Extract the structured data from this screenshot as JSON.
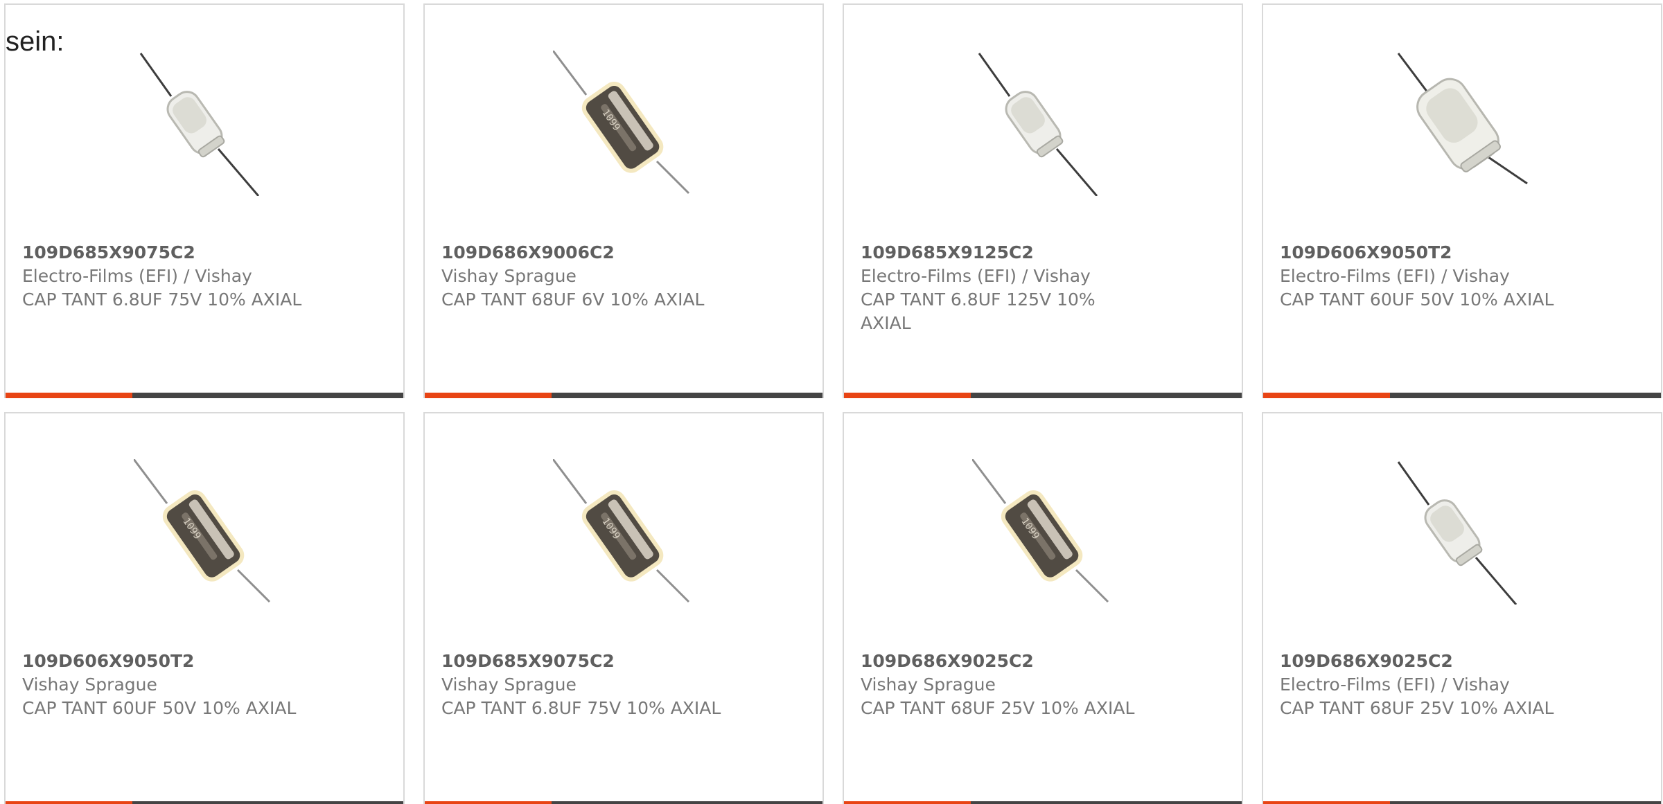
{
  "heading": "sein:",
  "colors": {
    "card_border": "#d9d9d9",
    "bar_dark": "#444444",
    "bar_accent": "#e84414",
    "text": "#777777"
  },
  "products": [
    {
      "part": "109D685X9075C2",
      "maker": "Electro-Films (EFI) / Vishay",
      "desc": "CAP TANT 6.8UF 75V 10% AXIAL",
      "image": "capacitor-clear-small-icon"
    },
    {
      "part": "109D686X9006C2",
      "maker": "Vishay Sprague",
      "desc": "CAP TANT 68UF 6V 10% AXIAL",
      "image": "capacitor-metal-icon"
    },
    {
      "part": "109D685X9125C2",
      "maker": "Electro-Films (EFI) / Vishay",
      "desc": "CAP TANT 6.8UF 125V 10% AXIAL",
      "image": "capacitor-clear-small-icon"
    },
    {
      "part": "109D606X9050T2",
      "maker": "Electro-Films (EFI) / Vishay",
      "desc": "CAP TANT 60UF 50V 10% AXIAL",
      "image": "capacitor-clear-large-icon"
    },
    {
      "part": "109D606X9050T2",
      "maker": "Vishay Sprague",
      "desc": "CAP TANT 60UF 50V 10% AXIAL",
      "image": "capacitor-metal-icon"
    },
    {
      "part": "109D685X9075C2",
      "maker": "Vishay Sprague",
      "desc": "CAP TANT 6.8UF 75V 10% AXIAL",
      "image": "capacitor-metal-icon"
    },
    {
      "part": "109D686X9025C2",
      "maker": "Vishay Sprague",
      "desc": "CAP TANT 68UF 25V 10% AXIAL",
      "image": "capacitor-metal-icon"
    },
    {
      "part": "109D686X9025C2",
      "maker": "Electro-Films (EFI) / Vishay",
      "desc": "CAP TANT 68UF 25V 10% AXIAL",
      "image": "capacitor-clear-small-icon"
    }
  ]
}
